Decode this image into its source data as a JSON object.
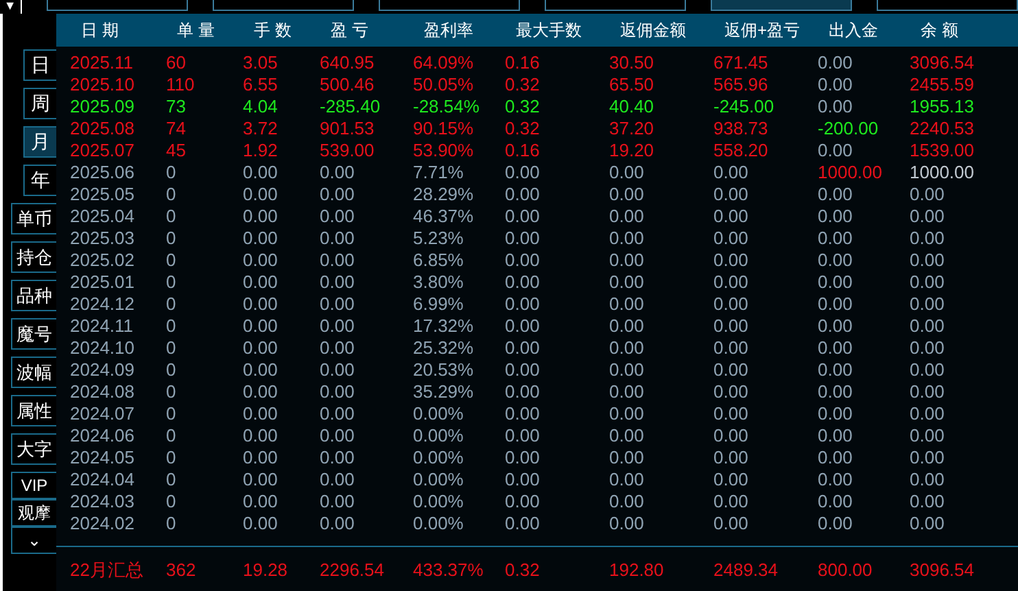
{
  "top_bar": {
    "menu_button": "▼"
  },
  "sidebar": [
    {
      "label": "日",
      "kind": "narrow",
      "selected": false
    },
    {
      "label": "周",
      "kind": "narrow",
      "selected": false
    },
    {
      "label": "月",
      "kind": "narrow",
      "selected": true
    },
    {
      "label": "年",
      "kind": "narrow",
      "selected": false
    },
    {
      "label": "单币",
      "kind": "wide",
      "selected": false
    },
    {
      "label": "持仓",
      "kind": "wide",
      "selected": false
    },
    {
      "label": "品种",
      "kind": "wide",
      "selected": false
    },
    {
      "label": "魔号",
      "kind": "wide",
      "selected": false
    },
    {
      "label": "波幅",
      "kind": "wide",
      "selected": false
    },
    {
      "label": "属性",
      "kind": "wide",
      "selected": false
    },
    {
      "label": "大字",
      "kind": "wide",
      "selected": false
    },
    {
      "label": "VIP",
      "kind": "compact",
      "selected": false
    },
    {
      "label": "观摩",
      "kind": "compact",
      "selected": false
    },
    {
      "label": "⌄",
      "kind": "compact",
      "selected": false
    }
  ],
  "table": {
    "columns": [
      "日 期",
      "单 量",
      "手 数",
      "盈 亏",
      "盈利率",
      "最大手数",
      "返佣金额",
      "返佣+盈亏",
      "出入金",
      "余 额"
    ],
    "rows": [
      {
        "cells": [
          {
            "text": "2025.11",
            "color": "#e8101a"
          },
          {
            "text": "60",
            "color": "#e8101a"
          },
          {
            "text": "3.05",
            "color": "#e8101a"
          },
          {
            "text": "640.95",
            "color": "#e8101a"
          },
          {
            "text": "64.09%",
            "color": "#e8101a"
          },
          {
            "text": "0.16",
            "color": "#e8101a"
          },
          {
            "text": "30.50",
            "color": "#e8101a"
          },
          {
            "text": "671.45",
            "color": "#e8101a"
          },
          {
            "text": "0.00",
            "color": "#8fa3b3"
          },
          {
            "text": "3096.54",
            "color": "#e8101a"
          }
        ]
      },
      {
        "cells": [
          {
            "text": "2025.10",
            "color": "#e8101a"
          },
          {
            "text": "110",
            "color": "#e8101a"
          },
          {
            "text": "6.55",
            "color": "#e8101a"
          },
          {
            "text": "500.46",
            "color": "#e8101a"
          },
          {
            "text": "50.05%",
            "color": "#e8101a"
          },
          {
            "text": "0.32",
            "color": "#e8101a"
          },
          {
            "text": "65.50",
            "color": "#e8101a"
          },
          {
            "text": "565.96",
            "color": "#e8101a"
          },
          {
            "text": "0.00",
            "color": "#8fa3b3"
          },
          {
            "text": "2455.59",
            "color": "#e8101a"
          }
        ]
      },
      {
        "cells": [
          {
            "text": "2025.09",
            "color": "#1ee81e"
          },
          {
            "text": "73",
            "color": "#1ee81e"
          },
          {
            "text": "4.04",
            "color": "#1ee81e"
          },
          {
            "text": "-285.40",
            "color": "#1ee81e"
          },
          {
            "text": "-28.54%",
            "color": "#1ee81e"
          },
          {
            "text": "0.32",
            "color": "#1ee81e"
          },
          {
            "text": "40.40",
            "color": "#1ee81e"
          },
          {
            "text": "-245.00",
            "color": "#1ee81e"
          },
          {
            "text": "0.00",
            "color": "#8fa3b3"
          },
          {
            "text": "1955.13",
            "color": "#1ee81e"
          }
        ]
      },
      {
        "cells": [
          {
            "text": "2025.08",
            "color": "#e8101a"
          },
          {
            "text": "74",
            "color": "#e8101a"
          },
          {
            "text": "3.72",
            "color": "#e8101a"
          },
          {
            "text": "901.53",
            "color": "#e8101a"
          },
          {
            "text": "90.15%",
            "color": "#e8101a"
          },
          {
            "text": "0.32",
            "color": "#e8101a"
          },
          {
            "text": "37.20",
            "color": "#e8101a"
          },
          {
            "text": "938.73",
            "color": "#e8101a"
          },
          {
            "text": "-200.00",
            "color": "#1ee81e"
          },
          {
            "text": "2240.53",
            "color": "#e8101a"
          }
        ]
      },
      {
        "cells": [
          {
            "text": "2025.07",
            "color": "#e8101a"
          },
          {
            "text": "45",
            "color": "#e8101a"
          },
          {
            "text": "1.92",
            "color": "#e8101a"
          },
          {
            "text": "539.00",
            "color": "#e8101a"
          },
          {
            "text": "53.90%",
            "color": "#e8101a"
          },
          {
            "text": "0.16",
            "color": "#e8101a"
          },
          {
            "text": "19.20",
            "color": "#e8101a"
          },
          {
            "text": "558.20",
            "color": "#e8101a"
          },
          {
            "text": "0.00",
            "color": "#8fa3b3"
          },
          {
            "text": "1539.00",
            "color": "#e8101a"
          }
        ]
      },
      {
        "cells": [
          {
            "text": "2025.06",
            "color": "#8fa3b3"
          },
          {
            "text": "0",
            "color": "#8fa3b3"
          },
          {
            "text": "0.00",
            "color": "#8fa3b3"
          },
          {
            "text": "0.00",
            "color": "#8fa3b3"
          },
          {
            "text": "7.71%",
            "color": "#8fa3b3"
          },
          {
            "text": "0.00",
            "color": "#8fa3b3"
          },
          {
            "text": "0.00",
            "color": "#8fa3b3"
          },
          {
            "text": "0.00",
            "color": "#8fa3b3"
          },
          {
            "text": "1000.00",
            "color": "#e8101a"
          },
          {
            "text": "1000.00",
            "color": "#c0c8d0"
          }
        ]
      },
      {
        "cells": [
          {
            "text": "2025.05",
            "color": "#8fa3b3"
          },
          {
            "text": "0",
            "color": "#8fa3b3"
          },
          {
            "text": "0.00",
            "color": "#8fa3b3"
          },
          {
            "text": "0.00",
            "color": "#8fa3b3"
          },
          {
            "text": "28.29%",
            "color": "#8fa3b3"
          },
          {
            "text": "0.00",
            "color": "#8fa3b3"
          },
          {
            "text": "0.00",
            "color": "#8fa3b3"
          },
          {
            "text": "0.00",
            "color": "#8fa3b3"
          },
          {
            "text": "0.00",
            "color": "#8fa3b3"
          },
          {
            "text": "0.00",
            "color": "#8fa3b3"
          }
        ]
      },
      {
        "cells": [
          {
            "text": "2025.04",
            "color": "#8fa3b3"
          },
          {
            "text": "0",
            "color": "#8fa3b3"
          },
          {
            "text": "0.00",
            "color": "#8fa3b3"
          },
          {
            "text": "0.00",
            "color": "#8fa3b3"
          },
          {
            "text": "46.37%",
            "color": "#8fa3b3"
          },
          {
            "text": "0.00",
            "color": "#8fa3b3"
          },
          {
            "text": "0.00",
            "color": "#8fa3b3"
          },
          {
            "text": "0.00",
            "color": "#8fa3b3"
          },
          {
            "text": "0.00",
            "color": "#8fa3b3"
          },
          {
            "text": "0.00",
            "color": "#8fa3b3"
          }
        ]
      },
      {
        "cells": [
          {
            "text": "2025.03",
            "color": "#8fa3b3"
          },
          {
            "text": "0",
            "color": "#8fa3b3"
          },
          {
            "text": "0.00",
            "color": "#8fa3b3"
          },
          {
            "text": "0.00",
            "color": "#8fa3b3"
          },
          {
            "text": "5.23%",
            "color": "#8fa3b3"
          },
          {
            "text": "0.00",
            "color": "#8fa3b3"
          },
          {
            "text": "0.00",
            "color": "#8fa3b3"
          },
          {
            "text": "0.00",
            "color": "#8fa3b3"
          },
          {
            "text": "0.00",
            "color": "#8fa3b3"
          },
          {
            "text": "0.00",
            "color": "#8fa3b3"
          }
        ]
      },
      {
        "cells": [
          {
            "text": "2025.02",
            "color": "#8fa3b3"
          },
          {
            "text": "0",
            "color": "#8fa3b3"
          },
          {
            "text": "0.00",
            "color": "#8fa3b3"
          },
          {
            "text": "0.00",
            "color": "#8fa3b3"
          },
          {
            "text": "6.85%",
            "color": "#8fa3b3"
          },
          {
            "text": "0.00",
            "color": "#8fa3b3"
          },
          {
            "text": "0.00",
            "color": "#8fa3b3"
          },
          {
            "text": "0.00",
            "color": "#8fa3b3"
          },
          {
            "text": "0.00",
            "color": "#8fa3b3"
          },
          {
            "text": "0.00",
            "color": "#8fa3b3"
          }
        ]
      },
      {
        "cells": [
          {
            "text": "2025.01",
            "color": "#8fa3b3"
          },
          {
            "text": "0",
            "color": "#8fa3b3"
          },
          {
            "text": "0.00",
            "color": "#8fa3b3"
          },
          {
            "text": "0.00",
            "color": "#8fa3b3"
          },
          {
            "text": "3.80%",
            "color": "#8fa3b3"
          },
          {
            "text": "0.00",
            "color": "#8fa3b3"
          },
          {
            "text": "0.00",
            "color": "#8fa3b3"
          },
          {
            "text": "0.00",
            "color": "#8fa3b3"
          },
          {
            "text": "0.00",
            "color": "#8fa3b3"
          },
          {
            "text": "0.00",
            "color": "#8fa3b3"
          }
        ]
      },
      {
        "cells": [
          {
            "text": "2024.12",
            "color": "#8fa3b3"
          },
          {
            "text": "0",
            "color": "#8fa3b3"
          },
          {
            "text": "0.00",
            "color": "#8fa3b3"
          },
          {
            "text": "0.00",
            "color": "#8fa3b3"
          },
          {
            "text": "6.99%",
            "color": "#8fa3b3"
          },
          {
            "text": "0.00",
            "color": "#8fa3b3"
          },
          {
            "text": "0.00",
            "color": "#8fa3b3"
          },
          {
            "text": "0.00",
            "color": "#8fa3b3"
          },
          {
            "text": "0.00",
            "color": "#8fa3b3"
          },
          {
            "text": "0.00",
            "color": "#8fa3b3"
          }
        ]
      },
      {
        "cells": [
          {
            "text": "2024.11",
            "color": "#8fa3b3"
          },
          {
            "text": "0",
            "color": "#8fa3b3"
          },
          {
            "text": "0.00",
            "color": "#8fa3b3"
          },
          {
            "text": "0.00",
            "color": "#8fa3b3"
          },
          {
            "text": "17.32%",
            "color": "#8fa3b3"
          },
          {
            "text": "0.00",
            "color": "#8fa3b3"
          },
          {
            "text": "0.00",
            "color": "#8fa3b3"
          },
          {
            "text": "0.00",
            "color": "#8fa3b3"
          },
          {
            "text": "0.00",
            "color": "#8fa3b3"
          },
          {
            "text": "0.00",
            "color": "#8fa3b3"
          }
        ]
      },
      {
        "cells": [
          {
            "text": "2024.10",
            "color": "#8fa3b3"
          },
          {
            "text": "0",
            "color": "#8fa3b3"
          },
          {
            "text": "0.00",
            "color": "#8fa3b3"
          },
          {
            "text": "0.00",
            "color": "#8fa3b3"
          },
          {
            "text": "25.32%",
            "color": "#8fa3b3"
          },
          {
            "text": "0.00",
            "color": "#8fa3b3"
          },
          {
            "text": "0.00",
            "color": "#8fa3b3"
          },
          {
            "text": "0.00",
            "color": "#8fa3b3"
          },
          {
            "text": "0.00",
            "color": "#8fa3b3"
          },
          {
            "text": "0.00",
            "color": "#8fa3b3"
          }
        ]
      },
      {
        "cells": [
          {
            "text": "2024.09",
            "color": "#8fa3b3"
          },
          {
            "text": "0",
            "color": "#8fa3b3"
          },
          {
            "text": "0.00",
            "color": "#8fa3b3"
          },
          {
            "text": "0.00",
            "color": "#8fa3b3"
          },
          {
            "text": "20.53%",
            "color": "#8fa3b3"
          },
          {
            "text": "0.00",
            "color": "#8fa3b3"
          },
          {
            "text": "0.00",
            "color": "#8fa3b3"
          },
          {
            "text": "0.00",
            "color": "#8fa3b3"
          },
          {
            "text": "0.00",
            "color": "#8fa3b3"
          },
          {
            "text": "0.00",
            "color": "#8fa3b3"
          }
        ]
      },
      {
        "cells": [
          {
            "text": "2024.08",
            "color": "#8fa3b3"
          },
          {
            "text": "0",
            "color": "#8fa3b3"
          },
          {
            "text": "0.00",
            "color": "#8fa3b3"
          },
          {
            "text": "0.00",
            "color": "#8fa3b3"
          },
          {
            "text": "35.29%",
            "color": "#8fa3b3"
          },
          {
            "text": "0.00",
            "color": "#8fa3b3"
          },
          {
            "text": "0.00",
            "color": "#8fa3b3"
          },
          {
            "text": "0.00",
            "color": "#8fa3b3"
          },
          {
            "text": "0.00",
            "color": "#8fa3b3"
          },
          {
            "text": "0.00",
            "color": "#8fa3b3"
          }
        ]
      },
      {
        "cells": [
          {
            "text": "2024.07",
            "color": "#8fa3b3"
          },
          {
            "text": "0",
            "color": "#8fa3b3"
          },
          {
            "text": "0.00",
            "color": "#8fa3b3"
          },
          {
            "text": "0.00",
            "color": "#8fa3b3"
          },
          {
            "text": "0.00%",
            "color": "#8fa3b3"
          },
          {
            "text": "0.00",
            "color": "#8fa3b3"
          },
          {
            "text": "0.00",
            "color": "#8fa3b3"
          },
          {
            "text": "0.00",
            "color": "#8fa3b3"
          },
          {
            "text": "0.00",
            "color": "#8fa3b3"
          },
          {
            "text": "0.00",
            "color": "#8fa3b3"
          }
        ]
      },
      {
        "cells": [
          {
            "text": "2024.06",
            "color": "#8fa3b3"
          },
          {
            "text": "0",
            "color": "#8fa3b3"
          },
          {
            "text": "0.00",
            "color": "#8fa3b3"
          },
          {
            "text": "0.00",
            "color": "#8fa3b3"
          },
          {
            "text": "0.00%",
            "color": "#8fa3b3"
          },
          {
            "text": "0.00",
            "color": "#8fa3b3"
          },
          {
            "text": "0.00",
            "color": "#8fa3b3"
          },
          {
            "text": "0.00",
            "color": "#8fa3b3"
          },
          {
            "text": "0.00",
            "color": "#8fa3b3"
          },
          {
            "text": "0.00",
            "color": "#8fa3b3"
          }
        ]
      },
      {
        "cells": [
          {
            "text": "2024.05",
            "color": "#8fa3b3"
          },
          {
            "text": "0",
            "color": "#8fa3b3"
          },
          {
            "text": "0.00",
            "color": "#8fa3b3"
          },
          {
            "text": "0.00",
            "color": "#8fa3b3"
          },
          {
            "text": "0.00%",
            "color": "#8fa3b3"
          },
          {
            "text": "0.00",
            "color": "#8fa3b3"
          },
          {
            "text": "0.00",
            "color": "#8fa3b3"
          },
          {
            "text": "0.00",
            "color": "#8fa3b3"
          },
          {
            "text": "0.00",
            "color": "#8fa3b3"
          },
          {
            "text": "0.00",
            "color": "#8fa3b3"
          }
        ]
      },
      {
        "cells": [
          {
            "text": "2024.04",
            "color": "#8fa3b3"
          },
          {
            "text": "0",
            "color": "#8fa3b3"
          },
          {
            "text": "0.00",
            "color": "#8fa3b3"
          },
          {
            "text": "0.00",
            "color": "#8fa3b3"
          },
          {
            "text": "0.00%",
            "color": "#8fa3b3"
          },
          {
            "text": "0.00",
            "color": "#8fa3b3"
          },
          {
            "text": "0.00",
            "color": "#8fa3b3"
          },
          {
            "text": "0.00",
            "color": "#8fa3b3"
          },
          {
            "text": "0.00",
            "color": "#8fa3b3"
          },
          {
            "text": "0.00",
            "color": "#8fa3b3"
          }
        ]
      },
      {
        "cells": [
          {
            "text": "2024.03",
            "color": "#8fa3b3"
          },
          {
            "text": "0",
            "color": "#8fa3b3"
          },
          {
            "text": "0.00",
            "color": "#8fa3b3"
          },
          {
            "text": "0.00",
            "color": "#8fa3b3"
          },
          {
            "text": "0.00%",
            "color": "#8fa3b3"
          },
          {
            "text": "0.00",
            "color": "#8fa3b3"
          },
          {
            "text": "0.00",
            "color": "#8fa3b3"
          },
          {
            "text": "0.00",
            "color": "#8fa3b3"
          },
          {
            "text": "0.00",
            "color": "#8fa3b3"
          },
          {
            "text": "0.00",
            "color": "#8fa3b3"
          }
        ]
      },
      {
        "cells": [
          {
            "text": "2024.02",
            "color": "#8fa3b3"
          },
          {
            "text": "0",
            "color": "#8fa3b3"
          },
          {
            "text": "0.00",
            "color": "#8fa3b3"
          },
          {
            "text": "0.00",
            "color": "#8fa3b3"
          },
          {
            "text": "0.00%",
            "color": "#8fa3b3"
          },
          {
            "text": "0.00",
            "color": "#8fa3b3"
          },
          {
            "text": "0.00",
            "color": "#8fa3b3"
          },
          {
            "text": "0.00",
            "color": "#8fa3b3"
          },
          {
            "text": "0.00",
            "color": "#8fa3b3"
          },
          {
            "text": "0.00",
            "color": "#8fa3b3"
          }
        ]
      }
    ],
    "summary": {
      "cells": [
        {
          "text": "22月汇总",
          "color": "#e8101a"
        },
        {
          "text": "362",
          "color": "#e8101a"
        },
        {
          "text": "19.28",
          "color": "#e8101a"
        },
        {
          "text": "2296.54",
          "color": "#e8101a"
        },
        {
          "text": "433.37%",
          "color": "#e8101a"
        },
        {
          "text": "0.32",
          "color": "#e8101a"
        },
        {
          "text": "192.80",
          "color": "#e8101a"
        },
        {
          "text": "2489.34",
          "color": "#e8101a"
        },
        {
          "text": "800.00",
          "color": "#e8101a"
        },
        {
          "text": "3096.54",
          "color": "#e8101a"
        }
      ]
    }
  }
}
